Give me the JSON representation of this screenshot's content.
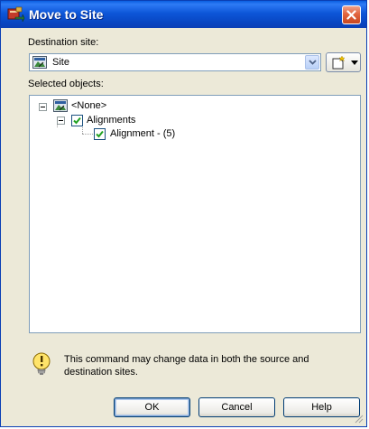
{
  "dialog": {
    "title": "Move to Site",
    "icons": {
      "app": "move-to-site-icon",
      "close": "close-icon"
    }
  },
  "destination": {
    "label": "Destination site:",
    "selected": "Site",
    "icon": "site-icon"
  },
  "selected_objects": {
    "label": "Selected objects:",
    "tree": [
      {
        "label": "<None>",
        "icon": "site-icon",
        "expanded": true,
        "checked": null
      },
      {
        "label": "Alignments",
        "expanded": true,
        "checked": true
      },
      {
        "label": "Alignment - (5)",
        "checked": true
      }
    ]
  },
  "info": {
    "icon": "info-lightbulb-icon",
    "message": "This command may change data in both the source and destination sites."
  },
  "buttons": {
    "ok": "OK",
    "cancel": "Cancel",
    "help": "Help"
  },
  "colors": {
    "titlebar": "#0a4fd0",
    "window_bg": "#ece9d8",
    "check_green": "#21a121"
  }
}
